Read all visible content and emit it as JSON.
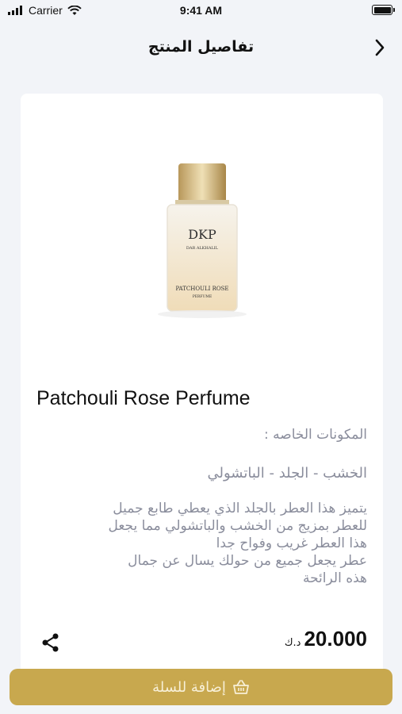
{
  "status_bar": {
    "carrier": "Carrier",
    "time": "9:41 AM"
  },
  "header": {
    "title": "تفاصيل المنتج",
    "back_icon": "chevron-right-icon"
  },
  "product": {
    "image_brand": "DKP",
    "image_subbrand": "DAR ALKHALIL",
    "image_label": "PATCHOULI ROSE",
    "image_sublabel": "PERFUME",
    "name": "Patchouli Rose Perfume",
    "ingredients_label": "المكونات الخاصه :",
    "ingredients_value": "الخشب - الجلد - الباتشولي",
    "description_lines": [
      "يتميز هذا العطر بالجلد الذي يعطي طابع جميل",
      "للعطر بمزيج من الخشب والباتشولي مما يجعل",
      "هذا العطر غريب وفواح جدا",
      "عطر يجعل جميع من حولك يسال عن جمال",
      "هذه الرائحة"
    ],
    "price": "20.000",
    "currency": "د.ك"
  },
  "actions": {
    "add_to_cart_label": "إضافة للسلة",
    "share_icon": "share-icon",
    "cart_icon": "basket-icon"
  },
  "colors": {
    "accent": "#c8a84e",
    "background": "#f2f4f8",
    "muted_text": "#8a8d9c"
  }
}
